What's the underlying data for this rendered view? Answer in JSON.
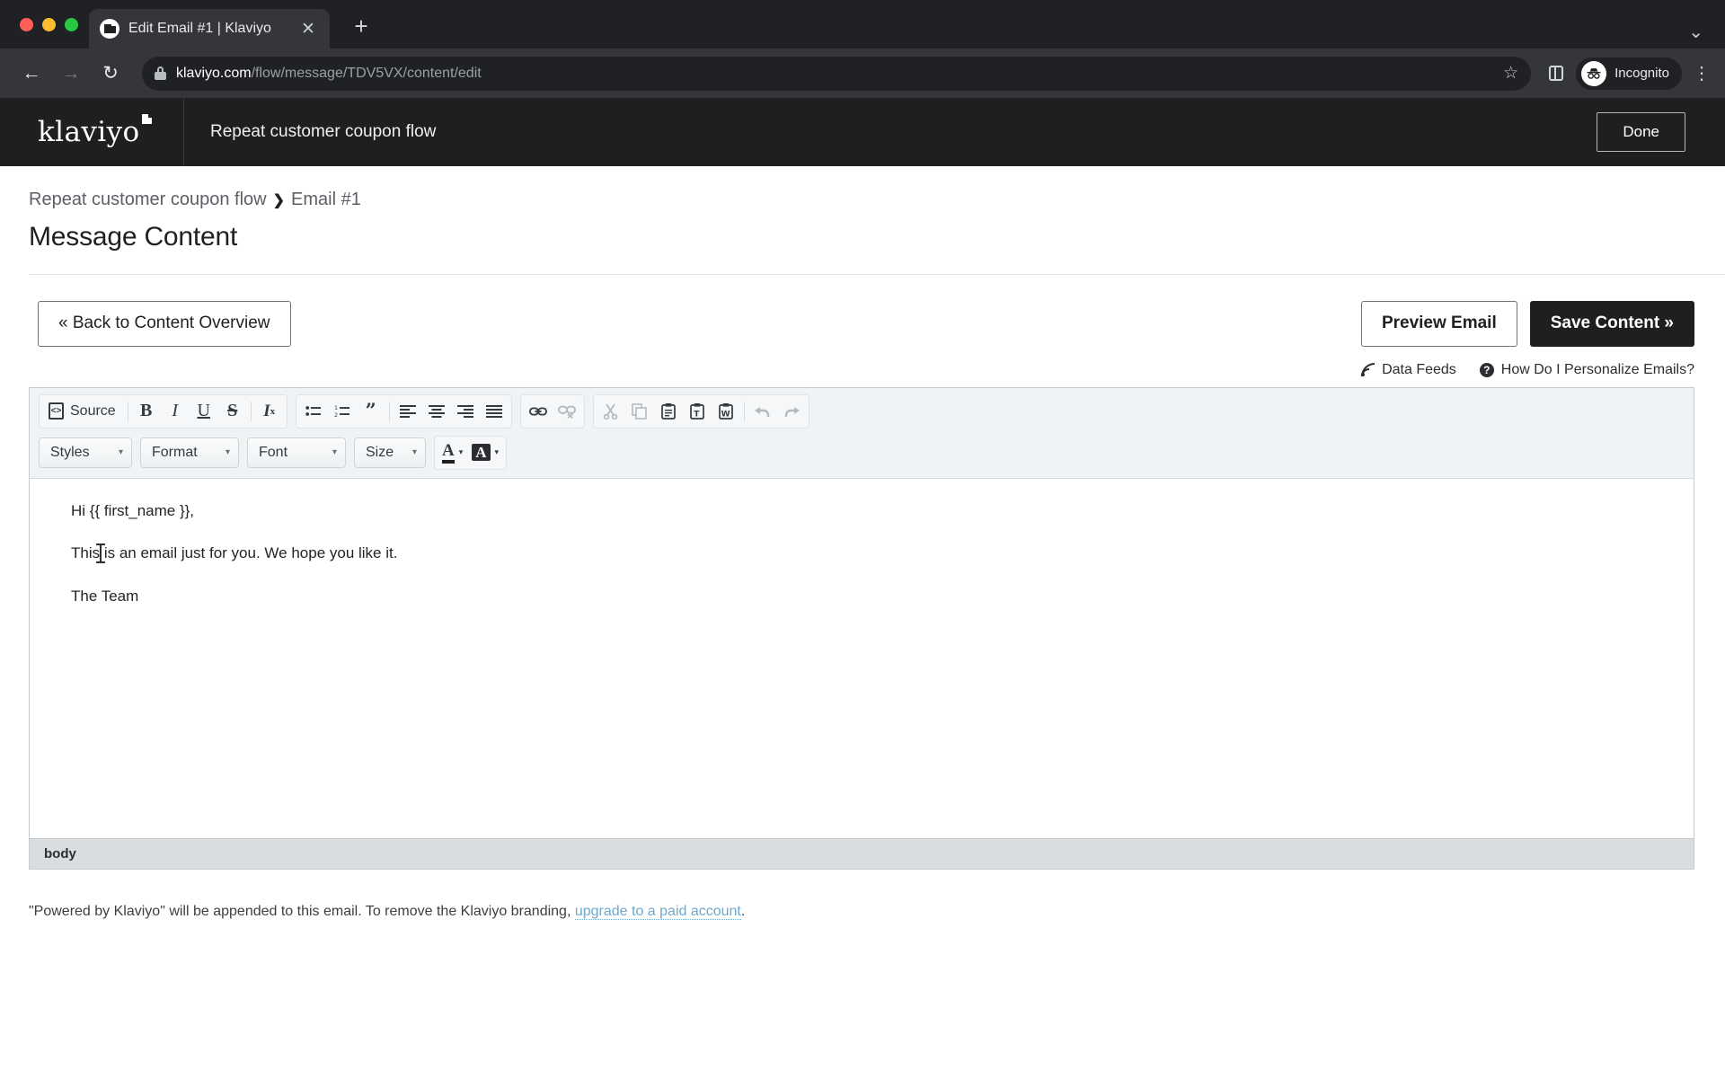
{
  "browser": {
    "tab": {
      "title": "Edit Email #1 | Klaviyo",
      "close_label": "✕",
      "favicon": "klaviyo-favicon"
    },
    "new_tab_label": "+",
    "tab_list_chevron": "⌄",
    "nav": {
      "back": "←",
      "forward": "→",
      "reload": "↻"
    },
    "url": {
      "host": "klaviyo.com",
      "path": "/flow/message/TDV5VX/content/edit"
    },
    "profile_label": "Incognito",
    "star_label": "☆"
  },
  "app_header": {
    "logo_text": "klaviyo",
    "flow_name": "Repeat customer coupon flow",
    "done_label": "Done"
  },
  "title_block": {
    "breadcrumb_parent": "Repeat customer coupon flow",
    "breadcrumb_sep": "❯",
    "breadcrumb_current": "Email #1",
    "page_title": "Message Content"
  },
  "actions": {
    "back_label": "« Back to Content Overview",
    "preview_label": "Preview Email",
    "save_label": "Save Content »"
  },
  "helpers": {
    "data_feeds": "Data Feeds",
    "personalize": "How Do I Personalize Emails?",
    "question_glyph": "?"
  },
  "editor": {
    "toolbar_row1": {
      "source": "Source",
      "bold": "B",
      "italic": "I",
      "underline": "U",
      "strike": "S",
      "remove_format": "I",
      "remove_format_sub": "x",
      "bulleted_list": "bulleted-list-icon",
      "numbered_list": "numbered-list-icon",
      "blockquote": "”",
      "align_left": "align-left-icon",
      "align_center": "align-center-icon",
      "align_right": "align-right-icon",
      "align_justify": "align-justify-icon",
      "link": "link-icon",
      "unlink": "unlink-icon",
      "cut": "cut-icon",
      "copy": "copy-icon",
      "paste": "paste-icon",
      "paste_text": "T",
      "paste_word": "W",
      "undo": "↩",
      "redo": "↪"
    },
    "toolbar_row2": {
      "styles": "Styles",
      "format": "Format",
      "font": "Font",
      "size": "Size",
      "text_color": "A",
      "bg_color": "A",
      "caret": "▾"
    },
    "content": {
      "line1": "Hi {{ first_name }},",
      "line2": "This is an email just for you. We hope you like it.",
      "line3": "The Team"
    },
    "status_path": "body"
  },
  "footnote": {
    "before": "\"Powered by Klaviyo\" will be appended to this email. To remove the Klaviyo branding, ",
    "link": "upgrade to a paid account",
    "after": "."
  },
  "colors": {
    "chrome_dark": "#202124",
    "tab_active": "#35363a",
    "app_header": "#1f1f1f",
    "accent_dark": "#1f1f1f",
    "toolbar_bg": "#eff3f5",
    "status_bg": "#d9dde0",
    "link_blue": "#6fa8c9"
  }
}
